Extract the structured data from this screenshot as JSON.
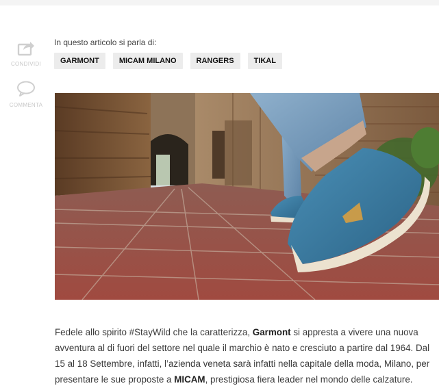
{
  "left_actions": {
    "share_label": "CONDIVIDI",
    "comment_label": "COMMENTA",
    "share_icon": "share-icon",
    "comment_icon": "comment-bubble-icon"
  },
  "tags_section": {
    "title": "In questo articolo si parla di:",
    "tags": [
      "GARMONT",
      "MICAM MILANO",
      "RANGERS",
      "TIKAL"
    ]
  },
  "hero_image": {
    "description_icon": "photo"
  },
  "article": {
    "p1_a": "Fedele allo spirito #StayWild che la caratterizza, ",
    "p1_brand": "Garmont",
    "p1_b": " si appresta a vivere una nuova avventura al di fuori del settore nel quale il marchio è nato e cresciuto a partire dal 1964. Dal 15 al 18 Settembre, infatti, l’azienda veneta sarà infatti nella capitale della moda, Milano, per presentare le sue proposte a ",
    "p1_event": "MICAM",
    "p1_c": ", prestigiosa fiera leader nel mondo delle calzature."
  },
  "colors": {
    "tag_bg": "#ececec",
    "icon_gray": "#c8c8c8",
    "brick": "#a0443a",
    "denim": "#6e93b6",
    "shoe": "#3d7ea6"
  }
}
